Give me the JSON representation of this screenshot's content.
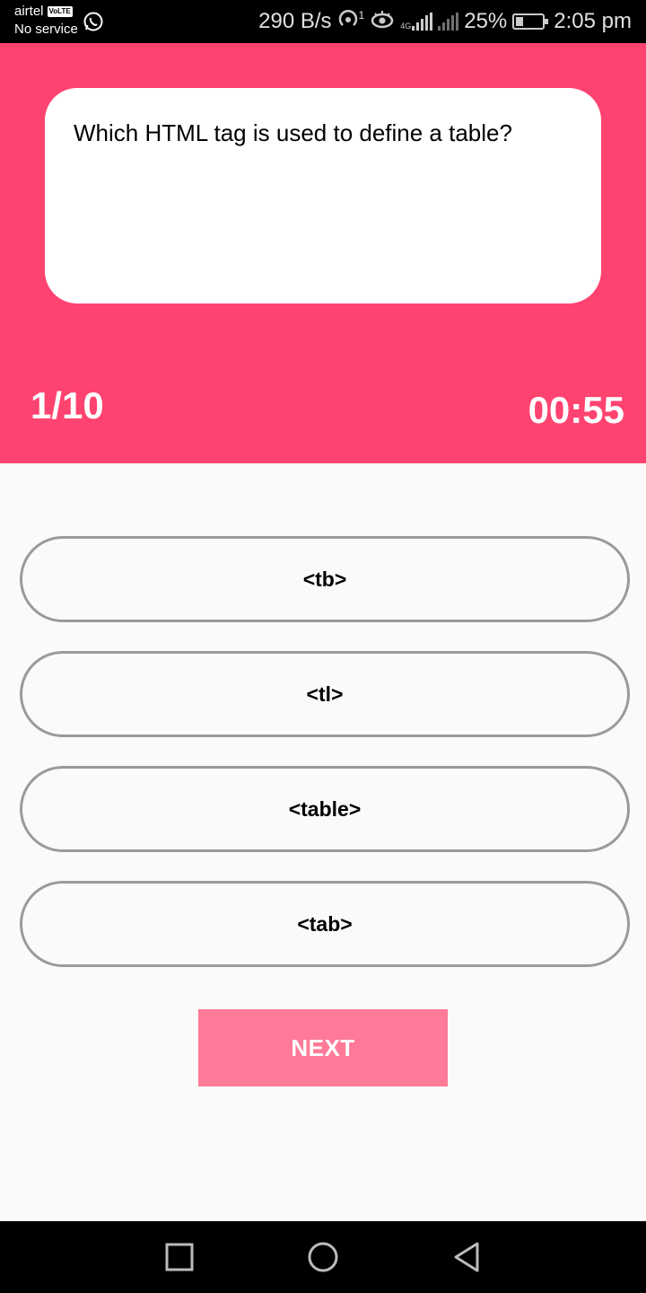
{
  "status_bar": {
    "carrier": "airtel",
    "volte_badge": "VoLTE",
    "service": "No service",
    "speed": "290 B/s",
    "hotspot_count": "1",
    "network_type": "4G",
    "battery": "25%",
    "time": "2:05 pm"
  },
  "quiz": {
    "question": "Which HTML tag is used to define a table?",
    "progress": "1/10",
    "timer": "00:55",
    "options": [
      "<tb>",
      "<tl>",
      "<table>",
      "<tab>"
    ],
    "next_label": "NEXT"
  },
  "colors": {
    "header": "#ff4370",
    "next_button": "#ff7a98",
    "option_border": "#9a9a9a"
  }
}
